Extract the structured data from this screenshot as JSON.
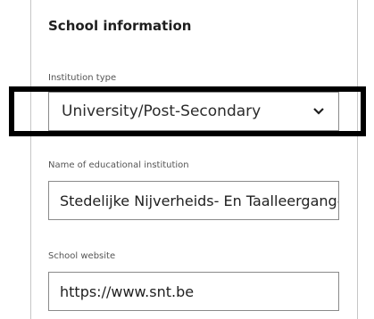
{
  "section": {
    "title": "School information"
  },
  "fields": {
    "institution_type": {
      "label": "Institution type",
      "value": "University/Post-Secondary"
    },
    "institution_name": {
      "label": "Name of educational institution",
      "value": "Stedelijke Nijverheids- En Taalleergangen"
    },
    "school_website": {
      "label": "School website",
      "value": "https://www.snt.be"
    }
  },
  "icons": {
    "dropdown": "chevron-down-icon"
  },
  "colors": {
    "highlight_border": "#000000",
    "field_border": "#8a8a8a",
    "text": "#1f1f1f"
  }
}
